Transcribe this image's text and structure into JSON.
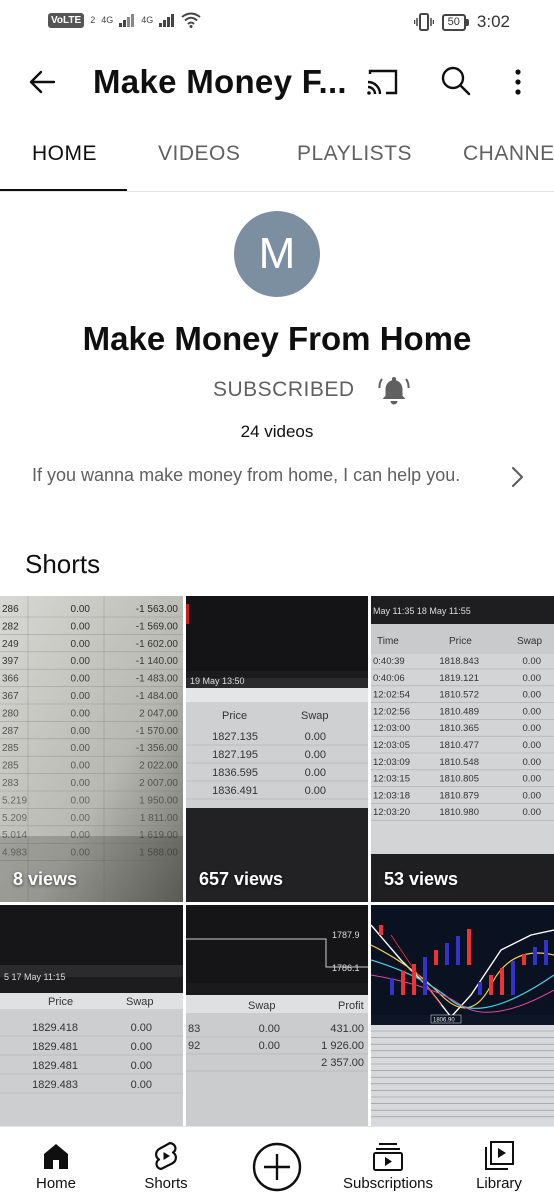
{
  "status_bar": {
    "volte": "VoLTE",
    "sim1": "2",
    "net1": "4G",
    "net2": "4G",
    "battery": "50",
    "time": "3:02"
  },
  "header": {
    "title": "Make Money F...",
    "icons": [
      "back-arrow-icon",
      "cast-icon",
      "search-icon",
      "more-vert-icon"
    ]
  },
  "tabs": [
    {
      "label": "HOME",
      "active": true
    },
    {
      "label": "VIDEOS",
      "active": false
    },
    {
      "label": "PLAYLISTS",
      "active": false
    },
    {
      "label": "CHANNE",
      "active": false
    }
  ],
  "channel": {
    "avatar_letter": "M",
    "avatar_color": "#7b8fa0",
    "name": "Make Money From Home",
    "subscribed_label": "SUBSCRIBED",
    "video_count": "24 videos",
    "description": "If you wanna make money from home, I can help you."
  },
  "shorts": {
    "heading": "Shorts",
    "items": [
      {
        "views": "8 views",
        "rows": [
          [
            "286",
            "0.00",
            "-1 563.00"
          ],
          [
            "282",
            "0.00",
            "-1 569.00"
          ],
          [
            "249",
            "0.00",
            "-1 602.00"
          ],
          [
            "397",
            "0.00",
            "-1 140.00"
          ],
          [
            "366",
            "0.00",
            "-1 483.00"
          ],
          [
            "367",
            "0.00",
            "-1 484.00"
          ],
          [
            "280",
            "0.00",
            "2 047.00"
          ],
          [
            "287",
            "0.00",
            "-1 570.00"
          ],
          [
            "285",
            "0.00",
            "-1 356.00"
          ],
          [
            "285",
            "0.00",
            "2 022.00"
          ],
          [
            "283",
            "0.00",
            "2 007.00"
          ],
          [
            "5.219",
            "0.00",
            "1 950.00"
          ],
          [
            "5.209",
            "0.00",
            "1 811.00"
          ],
          [
            "5.014",
            "0.00",
            "1 619.00"
          ],
          [
            "4.983",
            "0.00",
            "1 588.00"
          ]
        ]
      },
      {
        "views": "657 views",
        "stamp": "19 May 13:50",
        "headers": [
          "Price",
          "Swap"
        ],
        "rows": [
          [
            "1827.135",
            "0.00"
          ],
          [
            "1827.195",
            "0.00"
          ],
          [
            "1836.595",
            "0.00"
          ],
          [
            "1836.491",
            "0.00"
          ]
        ]
      },
      {
        "views": "53 views",
        "stamp": "May 11:35   18 May 11:55",
        "headers": [
          "Time",
          "Price",
          "Swap"
        ],
        "rows": [
          [
            "0:40:39",
            "1818.843",
            "0.00"
          ],
          [
            "0:40:06",
            "1819.121",
            "0.00"
          ],
          [
            "12:02:54",
            "1810.572",
            "0.00"
          ],
          [
            "12:02:56",
            "1810.489",
            "0.00"
          ],
          [
            "12:03:00",
            "1810.365",
            "0.00"
          ],
          [
            "12:03:05",
            "1810.477",
            "0.00"
          ],
          [
            "12:03:09",
            "1810.548",
            "0.00"
          ],
          [
            "12:03:15",
            "1810.805",
            "0.00"
          ],
          [
            "12:03:18",
            "1810.879",
            "0.00"
          ],
          [
            "12:03:20",
            "1810.980",
            "0.00"
          ]
        ]
      },
      {
        "stamp": "5  17 May 11:15",
        "headers": [
          "Price",
          "Swap"
        ],
        "rows": [
          [
            "1829.418",
            "0.00"
          ],
          [
            "1829.481",
            "0.00"
          ],
          [
            "1829.481",
            "0.00"
          ],
          [
            "1829.483",
            "0.00"
          ]
        ]
      },
      {
        "price_tags": [
          "1787.9",
          "1786.1"
        ],
        "headers": [
          "Swap",
          "Profit"
        ],
        "rows": [
          [
            "83",
            "0.00",
            "431.00"
          ],
          [
            "92",
            "0.00",
            "1 926.00"
          ],
          [
            "",
            "",
            "2 357.00"
          ]
        ]
      },
      {
        "chart_tag": "1806.90"
      }
    ]
  },
  "bottom_nav": [
    {
      "label": "Home",
      "icon": "home-icon"
    },
    {
      "label": "Shorts",
      "icon": "shorts-icon"
    },
    {
      "label": "",
      "icon": "create-icon"
    },
    {
      "label": "Subscriptions",
      "icon": "subscriptions-icon"
    },
    {
      "label": "Library",
      "icon": "library-icon"
    }
  ]
}
